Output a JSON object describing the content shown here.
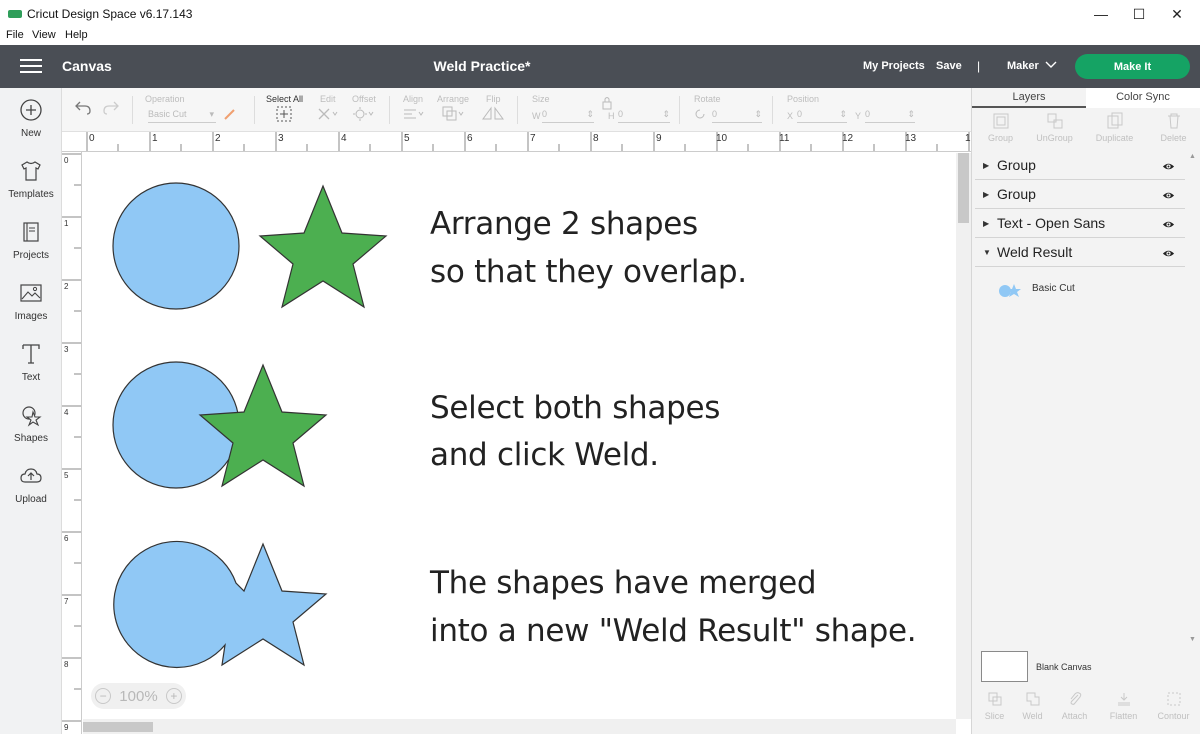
{
  "window": {
    "title": "Cricut Design Space  v6.17.143",
    "minimize": "—",
    "maximize": "☐",
    "close": "✕"
  },
  "menu": [
    "File",
    "View",
    "Help"
  ],
  "header": {
    "section": "Canvas",
    "doc_title": "Weld Practice*",
    "my_projects": "My Projects",
    "save": "Save",
    "separator": "|",
    "machine": "Maker",
    "make_it": "Make It"
  },
  "sidebar": [
    "New",
    "Templates",
    "Projects",
    "Images",
    "Text",
    "Shapes",
    "Upload"
  ],
  "toolbar": {
    "operation": "Operation",
    "operation_value": "Basic Cut",
    "select_all": "Select All",
    "edit": "Edit",
    "offset": "Offset",
    "align": "Align",
    "arrange": "Arrange",
    "flip": "Flip",
    "size": "Size",
    "w": "W",
    "h": "H",
    "rotate": "Rotate",
    "position": "Position",
    "x": "X",
    "y": "Y",
    "zero": "0"
  },
  "ruler": {
    "top": [
      "0",
      "1",
      "2",
      "3",
      "4",
      "5",
      "6",
      "7",
      "8",
      "9",
      "10",
      "11",
      "12",
      "13",
      "1"
    ],
    "left": [
      "0",
      "1",
      "2",
      "3",
      "4",
      "5",
      "6",
      "7",
      "8",
      "9"
    ]
  },
  "canvas": {
    "step1_line1": "Arrange 2 shapes",
    "step1_line2": "so that they overlap.",
    "step2_line1": "Select both shapes",
    "step2_line2": "and click Weld.",
    "step3_line1": "The shapes have merged",
    "step3_line2": "into a new \"Weld Result\" shape.",
    "zoom": "100%"
  },
  "colors": {
    "circle_fill": "#90c8f5",
    "star_fill": "#4caf50",
    "make_it": "#15a364",
    "header": "#4a4e55"
  },
  "panel": {
    "tabs": [
      "Layers",
      "Color Sync"
    ],
    "tools": [
      "Group",
      "UnGroup",
      "Duplicate",
      "Delete"
    ],
    "layers": [
      "Group",
      "Group",
      "Text - Open Sans",
      "Weld Result"
    ],
    "sublayer": "Basic Cut",
    "blank_canvas": "Blank Canvas",
    "bottom_tools": [
      "Slice",
      "Weld",
      "Attach",
      "Flatten",
      "Contour"
    ]
  }
}
